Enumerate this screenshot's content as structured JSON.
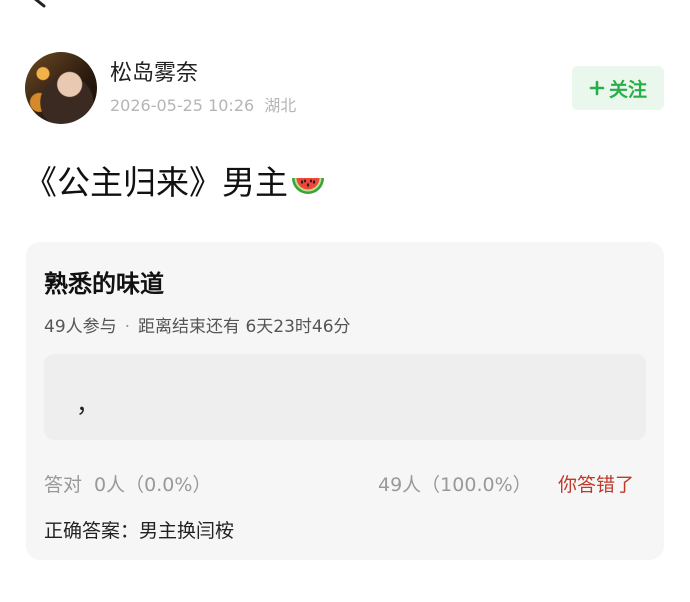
{
  "post": {
    "username": "松岛雾奈",
    "timestamp": "2026-05-25 10:26",
    "location": "湖北",
    "follow_label": "关注",
    "title": "《公主归来》男主",
    "title_emoji": "watermelon-emoji"
  },
  "poll": {
    "title": "熟悉的味道",
    "participants": "49人参与",
    "separator": "·",
    "deadline": "距离结束还有 6天23时46分",
    "option_text": "，",
    "correct_label": "答对",
    "correct_count": "0人（0.0%）",
    "wrong_count": "49人（100.0%）",
    "result": "你答错了",
    "answer": "正确答案：男主换闫桉"
  },
  "icons": {
    "back": "chevron-left-icon",
    "follow": "plus-icon"
  },
  "colors": {
    "follow_text": "#2aae4a",
    "follow_bg": "#e9f7ec",
    "wrong": "#c0392b",
    "card_bg": "#f6f6f6"
  }
}
